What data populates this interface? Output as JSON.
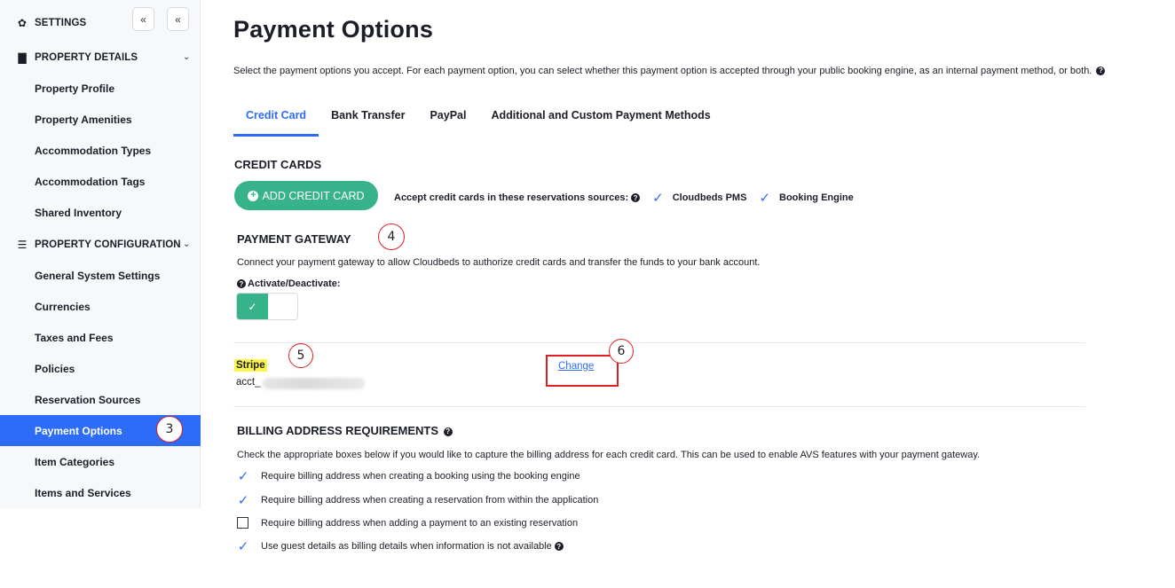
{
  "sidebar": {
    "settings_label": "SETTINGS",
    "collapse_up_icon": "double-chevron-up-icon",
    "collapse_left_icon": "double-chevron-left-icon",
    "property_details": {
      "label": "PROPERTY DETAILS",
      "items": [
        "Property Profile",
        "Property Amenities",
        "Accommodation Types",
        "Accommodation Tags",
        "Shared Inventory"
      ]
    },
    "property_configuration": {
      "label": "PROPERTY CONFIGURATION",
      "items": [
        "General System Settings",
        "Currencies",
        "Taxes and Fees",
        "Policies",
        "Reservation Sources",
        "Payment Options",
        "Item Categories",
        "Items and Services"
      ]
    },
    "active_item": "Payment Options"
  },
  "page": {
    "title": "Payment Options",
    "description": "Select the payment options you accept. For each payment option, you can select whether this payment option is accepted through your public booking engine, as an internal payment method, or both."
  },
  "tabs": [
    "Credit Card",
    "Bank Transfer",
    "PayPal",
    "Additional and Custom Payment Methods"
  ],
  "credit_cards": {
    "heading": "CREDIT CARDS",
    "add_button": "ADD CREDIT CARD",
    "accept_label": "Accept credit cards in these reservations sources:",
    "sources": [
      "Cloudbeds PMS",
      "Booking Engine"
    ]
  },
  "payment_gateway": {
    "heading": "PAYMENT GATEWAY",
    "description": "Connect your payment gateway to allow Cloudbeds to authorize credit cards and transfer the funds to your bank account.",
    "toggle_label": "Activate/Deactivate:",
    "toggle_on": true,
    "provider": "Stripe",
    "account_prefix": "acct_",
    "change_link": "Change"
  },
  "billing": {
    "heading": "BILLING ADDRESS REQUIREMENTS",
    "description": "Check the appropriate boxes below if you would like to capture the billing address for each credit card. This can be used to enable AVS features with your payment gateway.",
    "options": [
      {
        "label": "Require billing address when creating a booking using the booking engine",
        "checked": true
      },
      {
        "label": "Require billing address when creating a reservation from within the application",
        "checked": true
      },
      {
        "label": "Require billing address when adding a payment to an existing reservation",
        "checked": false
      },
      {
        "label": "Use guest details as billing details when information is not available",
        "checked": true
      }
    ]
  },
  "annotations": [
    "3",
    "4",
    "5",
    "6"
  ],
  "colors": {
    "accent": "#2d6cf6",
    "green": "#36b38a",
    "annotation": "#e02020",
    "highlight": "#fbf64a"
  }
}
